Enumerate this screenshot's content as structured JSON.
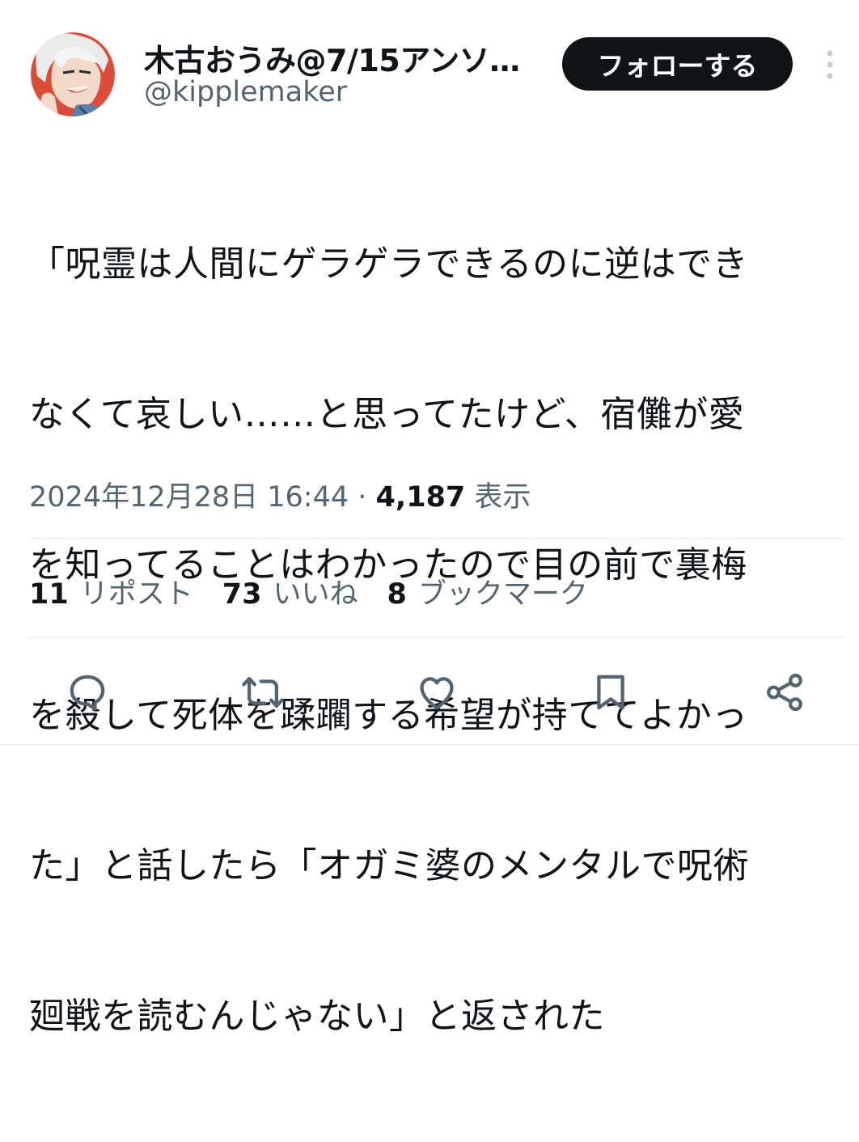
{
  "author": {
    "display_name": "木古おうみ@7/15アンソ…",
    "handle": "@kipplemaker",
    "avatar_icon": "user-avatar-illustration"
  },
  "header": {
    "follow_label": "フォローする",
    "more_icon": "more-vertical-icon"
  },
  "tweet": {
    "text": "「呪霊は人間にゲラゲラできるのに逆はできなくて哀しい……と思ってたけど、宿儺が愛を知ってることはわかったので目の前で裏梅を殺して死体を蹂躙する希望が持ててよかった」と話したら「オガミ婆のメンタルで呪術廻戦を読むんじゃない」と返された",
    "lines": [
      "「呪霊は人間にゲラゲラできるのに逆はでき",
      "なくて哀しい……と思ってたけど、宿儺が愛",
      "を知ってることはわかったので目の前で裏梅",
      "を殺して死体を蹂躙する希望が持ててよかっ",
      "た」と話したら「オガミ婆のメンタルで呪術",
      "廻戦を読むんじゃない」と返された"
    ],
    "timestamp": "2024年12月28日 16:44",
    "separator": "·",
    "views_count": "4,187",
    "views_label": "表示"
  },
  "stats": {
    "reposts_count": "11",
    "reposts_label": "リポスト",
    "likes_count": "73",
    "likes_label": "いいね",
    "bookmarks_count": "8",
    "bookmarks_label": "ブックマーク"
  },
  "actions": [
    {
      "name": "reply",
      "icon": "reply-icon"
    },
    {
      "name": "repost",
      "icon": "repost-icon"
    },
    {
      "name": "like",
      "icon": "heart-icon"
    },
    {
      "name": "bookmark",
      "icon": "bookmark-icon"
    },
    {
      "name": "share",
      "icon": "share-icon"
    }
  ],
  "colors": {
    "text_primary": "#0f1419",
    "text_secondary": "#536471",
    "divider": "#eff3f4",
    "follow_bg": "#0f1419",
    "follow_text": "#ffffff",
    "avatar_bg": "#e0533f"
  }
}
